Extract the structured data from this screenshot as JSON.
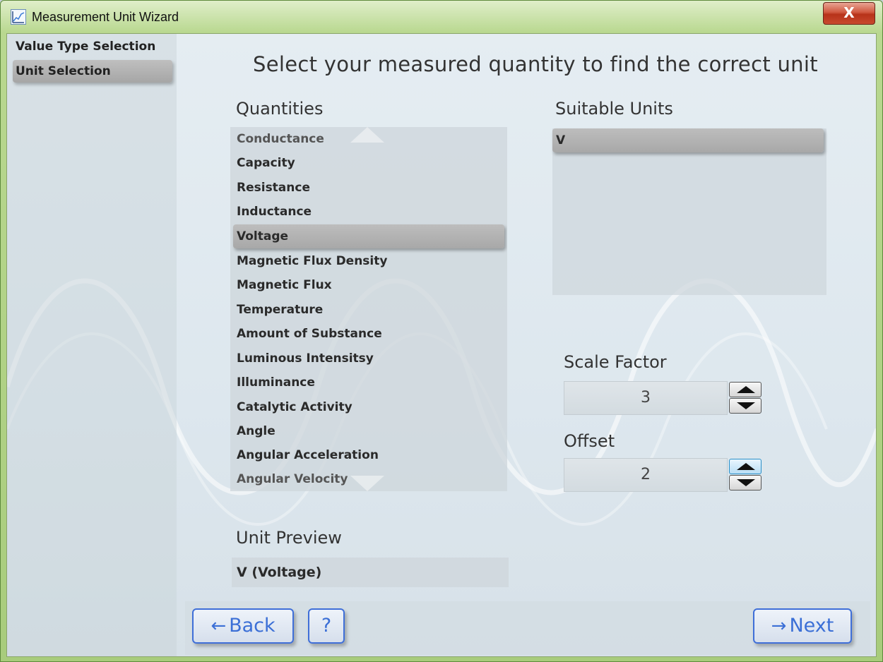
{
  "window": {
    "title": "Measurement Unit Wizard",
    "close_glyph": "X"
  },
  "sidebar": {
    "items": [
      {
        "label": "Value Type Selection",
        "selected": false
      },
      {
        "label": "Unit Selection",
        "selected": true
      }
    ]
  },
  "heading": "Select your measured quantity to find the correct unit",
  "quantities": {
    "label": "Quantities",
    "items": [
      {
        "label": "Conductance"
      },
      {
        "label": "Capacity"
      },
      {
        "label": "Resistance"
      },
      {
        "label": "Inductance"
      },
      {
        "label": "Voltage",
        "selected": true
      },
      {
        "label": "Magnetic Flux Density"
      },
      {
        "label": "Magnetic Flux"
      },
      {
        "label": "Temperature"
      },
      {
        "label": "Amount of Substance"
      },
      {
        "label": "Luminous Intensitsy"
      },
      {
        "label": "Illuminance"
      },
      {
        "label": "Catalytic Activity"
      },
      {
        "label": "Angle"
      },
      {
        "label": "Angular Acceleration"
      },
      {
        "label": "Angular Velocity"
      }
    ]
  },
  "units": {
    "label": "Suitable Units",
    "items": [
      {
        "label": "V",
        "selected": true
      }
    ]
  },
  "scale_factor": {
    "label": "Scale Factor",
    "value": "3"
  },
  "offset": {
    "label": "Offset",
    "value": "2"
  },
  "preview": {
    "label": "Unit Preview",
    "value": "V (Voltage)"
  },
  "buttons": {
    "back": "Back",
    "help": "?",
    "next": "Next",
    "back_arrow": "←",
    "next_arrow": "→"
  },
  "colors": {
    "accent": "#3f6fd8",
    "title_bar": "#b9d890",
    "selection": "#a8a8a8"
  },
  "icons": {
    "app": "chart-icon",
    "close": "close-icon",
    "spin_up": "triangle-up-icon",
    "spin_down": "triangle-down-icon"
  }
}
